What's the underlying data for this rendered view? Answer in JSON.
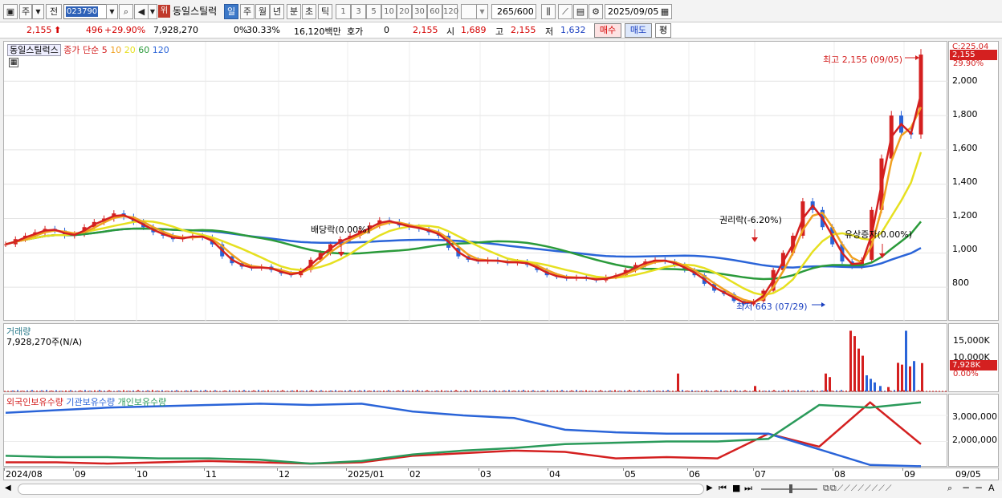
{
  "toolbar": {
    "period_mode": "주",
    "prev_label": "전",
    "code": "023790",
    "wi_badge": "위",
    "stock_name": "동일스틸럭",
    "period_tabs": [
      "일",
      "주",
      "월",
      "년",
      "분",
      "초",
      "틱"
    ],
    "active_period": "일",
    "intervals": [
      "1",
      "3",
      "5",
      "10",
      "20",
      "30",
      "60",
      "120"
    ],
    "count": "265",
    "count_total": "/600",
    "date": "2025/09/05"
  },
  "quote": {
    "price": "2,155",
    "change": "496",
    "change_pct": "+29.90%",
    "volume": "7,928,270",
    "ratio1": "0%",
    "ratio2": "30.33%",
    "amount": "16,120백만",
    "hoga_label": "호가",
    "hoga_value": "0",
    "hoga_price": "2,155",
    "open_label": "시",
    "open": "1,689",
    "high_label": "고",
    "high": "2,155",
    "low_label": "저",
    "low": "1,632",
    "buy_label": "매수",
    "sell_label": "매도",
    "avg_label": "평"
  },
  "price_legend": {
    "name": "동일스틸럭스",
    "series_label": "종가 단순",
    "ma": [
      {
        "label": "5",
        "color": "#d42020"
      },
      {
        "label": "10",
        "color": "#f0a020"
      },
      {
        "label": "20",
        "color": "#e6e020"
      },
      {
        "label": "60",
        "color": "#2a9a3a"
      },
      {
        "label": "120",
        "color": "#2a64d8"
      }
    ]
  },
  "annotations": {
    "high": "최고 2,155 (09/05)",
    "low": "최저 663 (07/29)",
    "dividend": "배당락(0.00%)",
    "rights": "권리락(-6.20%)",
    "capital": "유상증자(0.00%)"
  },
  "price_axis": {
    "ticks": [
      "2,000",
      "1,800",
      "1,600",
      "1,400",
      "1,200",
      "1,000",
      "800"
    ],
    "current_label": "2,155",
    "current_pct": "29.90%",
    "top_clip": "C:225.04"
  },
  "volume_legend": {
    "title": "거래량",
    "value": "7,928,270주(N/A)"
  },
  "volume_axis": {
    "ticks": [
      "15,000K",
      "10,000K"
    ],
    "current_label": "7,928K",
    "current_pct": "0.00%"
  },
  "holding_legend": {
    "items": [
      {
        "label": "외국인보유수량",
        "color": "#d42020"
      },
      {
        "label": "기관보유수량",
        "color": "#2a64d8"
      },
      {
        "label": "개인보유수량",
        "color": "#2a9a5a"
      }
    ]
  },
  "holding_axis": {
    "ticks": [
      "3,000,000",
      "2,000,000"
    ]
  },
  "date_axis": {
    "labels": [
      "2024/08",
      "09",
      "10",
      "11",
      "12",
      "2025/01",
      "02",
      "03",
      "04",
      "05",
      "06",
      "07",
      "08",
      "09"
    ],
    "right_label": "09/05"
  },
  "chart_data": [
    {
      "type": "line",
      "title": "동일스틸럭스 일봉",
      "x_unit": "trading day index (0=2024/08/01)",
      "ylim": [
        600,
        2230
      ],
      "series": [
        {
          "name": "종가",
          "values": [
            1050,
            1080,
            1100,
            1120,
            1140,
            1130,
            1100,
            1110,
            1150,
            1180,
            1200,
            1230,
            1210,
            1180,
            1150,
            1120,
            1100,
            1080,
            1090,
            1100,
            1090,
            1050,
            980,
            940,
            920,
            910,
            920,
            900,
            880,
            870,
            900,
            960,
            1000,
            1050,
            1080,
            1100,
            1130,
            1160,
            1190,
            1180,
            1160,
            1150,
            1140,
            1120,
            1100,
            1030,
            980,
            960,
            950,
            960,
            950,
            940,
            950,
            930,
            900,
            870,
            860,
            850,
            860,
            850,
            840,
            860,
            870,
            900,
            930,
            950,
            960,
            950,
            930,
            900,
            870,
            820,
            780,
            760,
            720,
            700,
            720,
            780,
            900,
            1000,
            1100,
            1300,
            1250,
            1150,
            1050,
            950,
            920,
            960,
            1250,
            1550,
            1800,
            1700,
            1690,
            2155
          ]
        }
      ]
    },
    {
      "type": "bar",
      "title": "거래량",
      "unit": "K shares",
      "ylim": [
        0,
        18000
      ],
      "notable": [
        {
          "x": "2025/06",
          "value": 5000
        },
        {
          "x": "2025/07",
          "value": 1500
        },
        {
          "x": "2025/08",
          "value": 17000
        },
        {
          "x": "2025/09/05",
          "value": 7928
        }
      ]
    },
    {
      "type": "line",
      "title": "보유수량",
      "ylim": [
        1000000,
        3800000
      ],
      "series": [
        {
          "name": "외국인보유수량",
          "values": [
            1200000,
            1200000,
            1150000,
            1200000,
            1250000,
            1200000,
            1150000,
            1200000,
            1450000,
            1550000,
            1650000,
            1600000,
            1350000,
            1400000,
            1350000,
            2300000,
            1800000,
            3500000,
            1900000
          ]
        },
        {
          "name": "기관보유수량",
          "values": [
            3100000,
            3200000,
            3300000,
            3350000,
            3400000,
            3450000,
            3400000,
            3450000,
            3150000,
            3000000,
            2900000,
            2450000,
            2350000,
            2300000,
            2300000,
            2300000,
            1700000,
            1100000,
            1050000
          ]
        },
        {
          "name": "개인보유수량",
          "values": [
            1450000,
            1400000,
            1400000,
            1350000,
            1350000,
            1300000,
            1150000,
            1250000,
            1500000,
            1650000,
            1750000,
            1900000,
            1950000,
            2000000,
            2000000,
            2100000,
            3400000,
            3300000,
            3500000
          ]
        }
      ]
    }
  ]
}
